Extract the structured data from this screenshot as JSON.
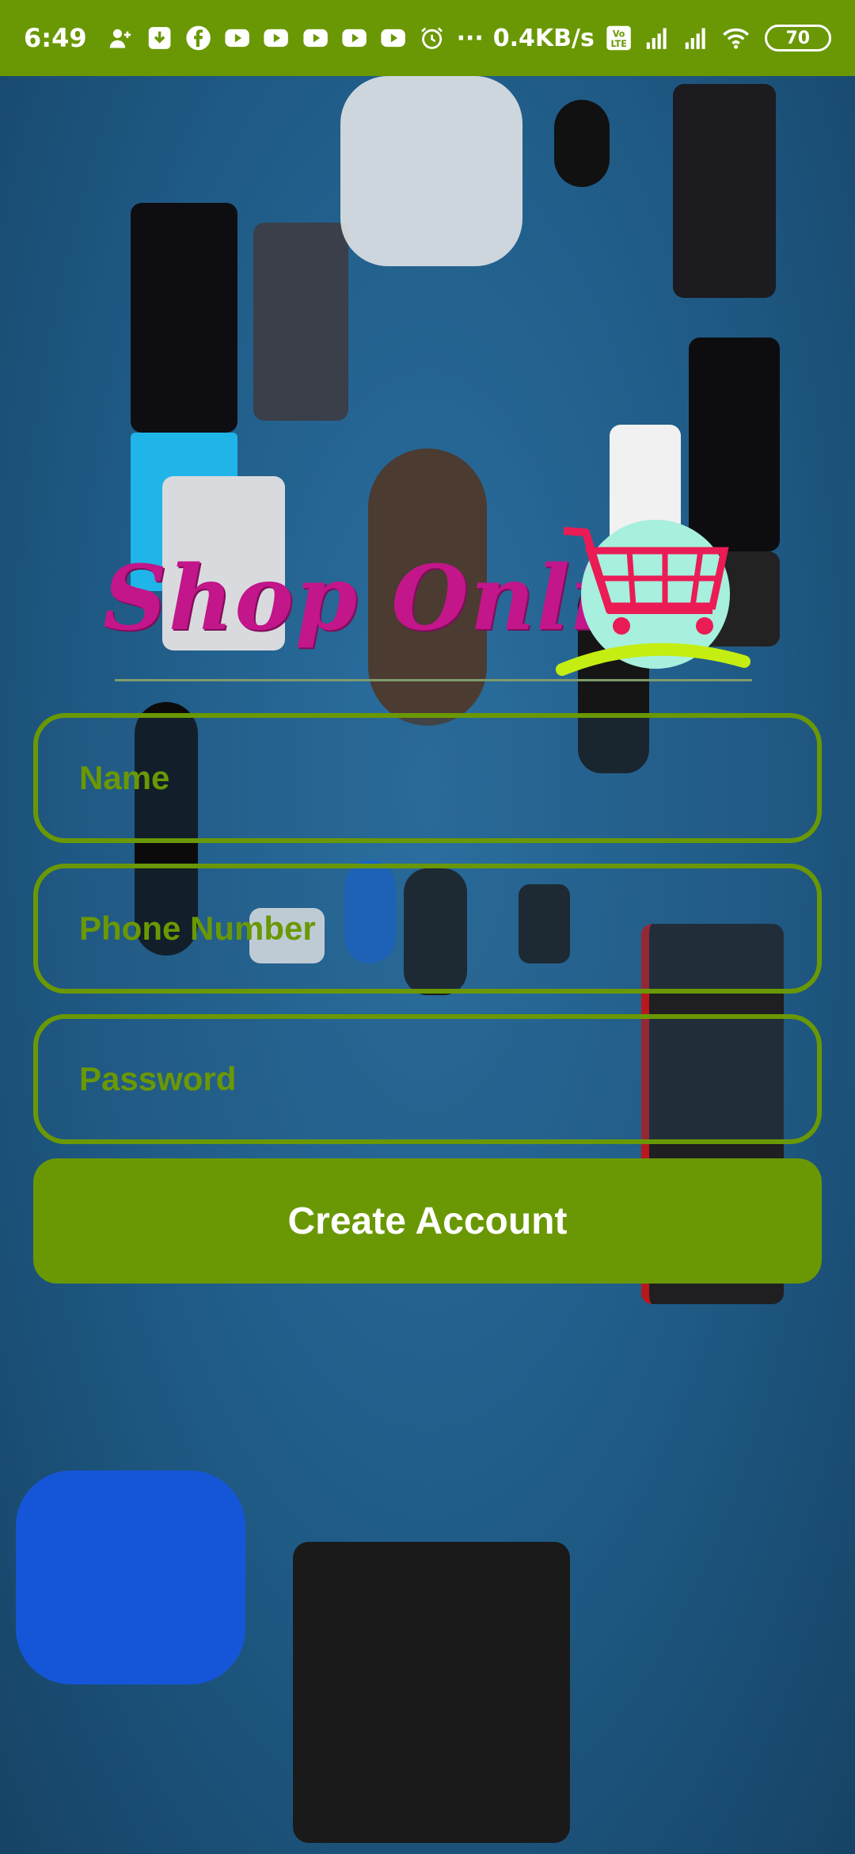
{
  "status_bar": {
    "time": "6:49",
    "network_speed": "0.4KB/s",
    "more": "···",
    "battery": "70",
    "icons": [
      "add-person-icon",
      "download-icon",
      "facebook-icon",
      "youtube-icon",
      "youtube-icon",
      "youtube-icon",
      "youtube-icon",
      "youtube-icon",
      "alarm-icon",
      "volte-icon",
      "signal-icon",
      "signal-icon",
      "wifi-icon",
      "battery-icon"
    ]
  },
  "logo": {
    "text": "Shop Online",
    "cart_icon": "shopping-cart-icon"
  },
  "form": {
    "name_placeholder": "Name",
    "phone_placeholder": "Phone Number",
    "password_placeholder": "Password",
    "name_value": "",
    "phone_value": "",
    "password_value": "",
    "create_label": "Create Account"
  },
  "colors": {
    "accent": "#6a9804",
    "logo_text": "#c2168a",
    "background": "#1f5a85"
  }
}
